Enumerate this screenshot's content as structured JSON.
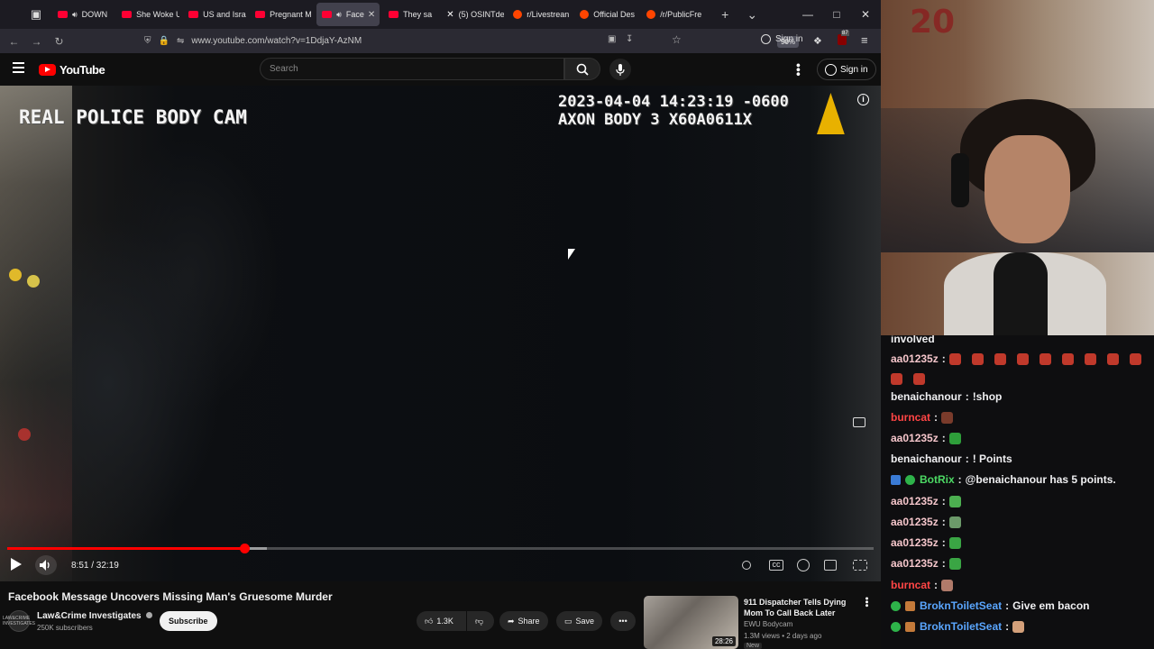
{
  "browser": {
    "tabs": [
      {
        "label": "DOWN",
        "favicon": "youtube",
        "audio": true,
        "active": false
      },
      {
        "label": "She Woke U",
        "favicon": "youtube",
        "audio": false,
        "active": false
      },
      {
        "label": "US and Isra",
        "favicon": "youtube",
        "audio": false,
        "active": false
      },
      {
        "label": "Pregnant M",
        "favicon": "youtube",
        "audio": false,
        "active": false
      },
      {
        "label": "Face",
        "favicon": "youtube",
        "audio": true,
        "active": true
      },
      {
        "label": "They sa",
        "favicon": "youtube",
        "audio": false,
        "active": false
      },
      {
        "label": "(5) OSINTde",
        "favicon": "x",
        "audio": false,
        "active": false
      },
      {
        "label": "r/Livestrean",
        "favicon": "reddit",
        "audio": false,
        "active": false
      },
      {
        "label": "Official Des",
        "favicon": "reddit",
        "audio": false,
        "active": false
      },
      {
        "label": "/r/PublicFre",
        "favicon": "reddit",
        "audio": false,
        "active": false
      }
    ],
    "url": "www.youtube.com/watch?v=1DdjaY-AzNM",
    "zoom": "90%",
    "signin_label": "Sign in",
    "extension_badge": "87"
  },
  "youtube": {
    "logo_text": "YouTube",
    "search_placeholder": "Search",
    "signin_label": "Sign in"
  },
  "video": {
    "overlay_title": "REAL POLICE BODY CAM",
    "timestamp_line1": "2023-04-04 14:23:19 -0600",
    "timestamp_line2": "AXON BODY 3 X60A0611X",
    "current_time": "8:51",
    "duration": "32:19",
    "time_display": "8:51 / 32:19",
    "progress_fraction": 0.274,
    "buffered_fraction": 0.3
  },
  "details": {
    "title": "Facebook Message Uncovers Missing Man's Gruesome Murder",
    "channel": "Law&Crime Investigates",
    "subscribers": "250K subscribers",
    "avatar_text": "LAW&CRIME INVESTIGATES",
    "subscribe_label": "Subscribe",
    "likes": "1.3K",
    "share_label": "Share",
    "save_label": "Save"
  },
  "recommended": {
    "title": "911 Dispatcher Tells Dying Mom To Call Back Later",
    "channel": "EWU Bodycam",
    "meta": "1.3M views • 2 days ago",
    "duration": "28:26",
    "badge": "New"
  },
  "webcam": {
    "score_text": "20"
  },
  "chat": {
    "partial_top": "involved",
    "messages": [
      {
        "user": "aa01235z",
        "color": "#f5c6cb",
        "text": "",
        "emotes": 10,
        "emote_color": "#c0392b"
      },
      {
        "user": "benaichanour",
        "color": "#efeff1",
        "text": "!shop",
        "emotes": 0
      },
      {
        "user": "burncat",
        "color": "#ff4545",
        "text": "",
        "emotes": 1,
        "emote_color": "#7a3b2b"
      },
      {
        "user": "aa01235z",
        "color": "#f5c6cb",
        "text": "",
        "emotes": 1,
        "emote_color": "#2e9e3a"
      },
      {
        "user": "benaichanour",
        "color": "#efeff1",
        "text": "! Points",
        "emotes": 0
      },
      {
        "user": "BotRix",
        "color": "#4cd964",
        "text": "@benaichanour has 5 points.",
        "emotes": 0,
        "badges": [
          "bot",
          "verified"
        ]
      },
      {
        "user": "aa01235z",
        "color": "#f5c6cb",
        "text": "",
        "emotes": 1,
        "emote_color": "#4caf50"
      },
      {
        "user": "aa01235z",
        "color": "#f5c6cb",
        "text": "",
        "emotes": 1,
        "emote_color": "#6c9a6a"
      },
      {
        "user": "aa01235z",
        "color": "#f5c6cb",
        "text": "",
        "emotes": 1,
        "emote_color": "#3aa544"
      },
      {
        "user": "aa01235z",
        "color": "#f5c6cb",
        "text": "",
        "emotes": 1,
        "emote_color": "#3aa544"
      },
      {
        "user": "burncat",
        "color": "#ff4545",
        "text": "",
        "emotes": 1,
        "emote_color": "#b07a6a"
      },
      {
        "user": "BroknToiletSeat",
        "color": "#5aa6ff",
        "text": "Give em bacon",
        "emotes": 0,
        "badges": [
          "person",
          "flag"
        ]
      },
      {
        "user": "BroknToiletSeat",
        "color": "#5aa6ff",
        "text": "",
        "emotes": 1,
        "emote_color": "#d4a07a",
        "badges": [
          "person",
          "flag"
        ]
      }
    ]
  },
  "colors": {
    "yt_red": "#ff0000",
    "axon_yellow": "#e8b100",
    "browser_tabbar": "#1c1b22",
    "chat_bg": "#0e0e10"
  }
}
